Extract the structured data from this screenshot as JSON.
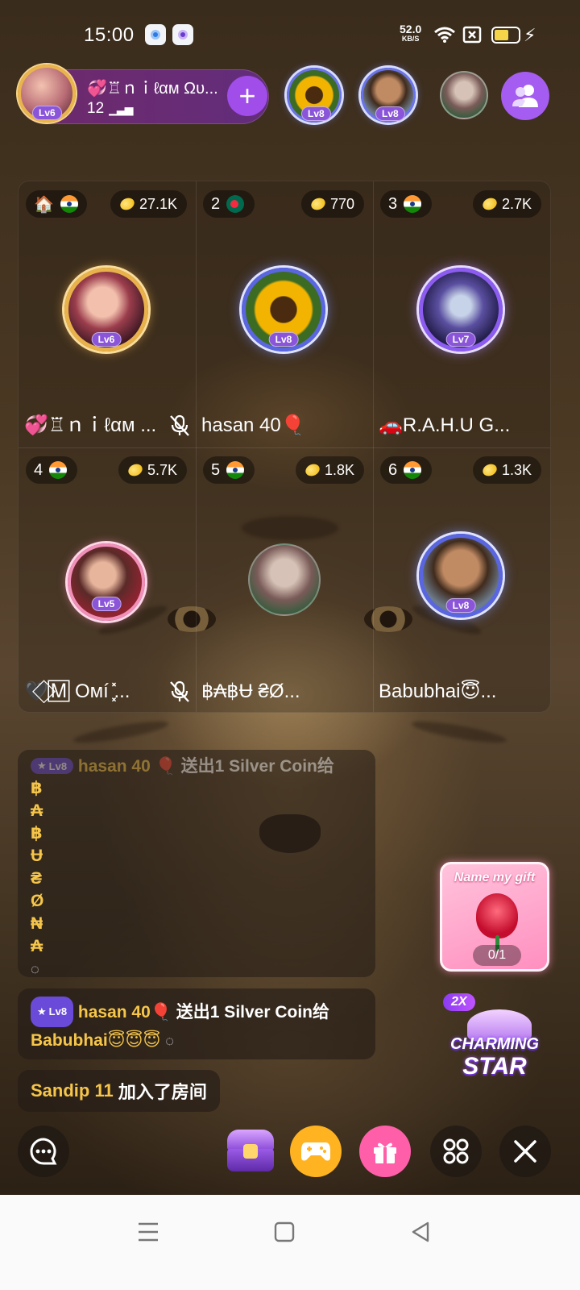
{
  "status_bar": {
    "time": "15:00",
    "net_speed_value": "52.0",
    "net_speed_unit": "KB/S",
    "battery_level_fraction": 0.6,
    "icons": [
      "app-notification-blue-icon",
      "app-notification-purple-icon",
      "wifi-icon",
      "no-sim-icon",
      "battery-icon",
      "charging-icon"
    ]
  },
  "room": {
    "host_name": "💞♖ｎｉℓαм Ωυ...",
    "member_count": "12",
    "host_level": "Lv6",
    "follow_label": "+",
    "audience": [
      {
        "level": "Lv8",
        "avatar": "sunflower-avatar"
      },
      {
        "level": "Lv8",
        "avatar": "man-avatar"
      },
      {
        "level": "",
        "avatar": "bengali-text-avatar"
      }
    ]
  },
  "seats": [
    {
      "index_label": "🏠",
      "flag": "india",
      "coins": "27.1K",
      "level": "Lv6",
      "name": "💞♖ｎｉℓαм ...",
      "muted": true
    },
    {
      "index_label": "2",
      "flag": "bangladesh",
      "coins": "770",
      "level": "Lv8",
      "name": "hasan 40🎈",
      "muted": false
    },
    {
      "index_label": "3",
      "flag": "india",
      "coins": "2.7K",
      "level": "Lv7",
      "name": "🚗R.A.H.U G...",
      "muted": false
    },
    {
      "index_label": "4",
      "flag": "india",
      "coins": "5.7K",
      "level": "Lv5",
      "name": "🖤⃟🄼 Oмí ͓̽...",
      "muted": true
    },
    {
      "index_label": "5",
      "flag": "india",
      "coins": "1.8K",
      "level": "",
      "name": "฿₳฿Ʉ ₴Ø...",
      "muted": false
    },
    {
      "index_label": "6",
      "flag": "india",
      "coins": "1.3K",
      "level": "Lv8",
      "name": "Babubhai😇...",
      "muted": false
    }
  ],
  "chat": {
    "faded_message": {
      "level": "Lv8",
      "user": "hasan 40",
      "text": "送出1 Silver Coin给"
    },
    "vertical_name": [
      "฿",
      "₳",
      "฿",
      "Ʉ",
      "₴",
      "Ø",
      "₦",
      "₳"
    ],
    "gift_message": {
      "level": "Lv8",
      "user": "hasan 40🎈",
      "text": "送出1 Silver Coin给",
      "recipient": "Babubhai😇😇😇"
    },
    "join_message": {
      "user": "Sandip 11",
      "text": "加入了房间"
    }
  },
  "widgets": {
    "name_my_gift": {
      "title": "Name my gift",
      "progress": "0/1"
    },
    "charming_star": {
      "multiplier": "2X",
      "line1": "CHARMING",
      "line2": "STAR"
    }
  },
  "colors": {
    "accent_purple": "#a04dea",
    "gold_text": "#f6c64a",
    "level_badge": "#6a4bd9"
  }
}
